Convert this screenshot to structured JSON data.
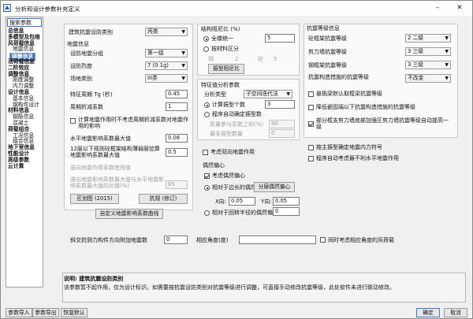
{
  "window": {
    "title": "分析和设计参数补充定义"
  },
  "search": {
    "value": "搜索参数"
  },
  "nav": [
    {
      "label": "总信息",
      "level": 0
    },
    {
      "label": "多模型及包络",
      "level": 0
    },
    {
      "label": "风荷载信息",
      "level": 0
    },
    {
      "label": "地震信息",
      "level": 1
    },
    {
      "label": "隔震信息",
      "level": 1,
      "selected": true
    },
    {
      "label": "活荷载信息",
      "level": 0
    },
    {
      "label": "二阶效应",
      "level": 0
    },
    {
      "label": "调整信息",
      "level": 0
    },
    {
      "label": "刚度调整",
      "level": 1
    },
    {
      "label": "内力调整",
      "level": 1
    },
    {
      "label": "设计信息",
      "level": 0
    },
    {
      "label": "基本信息",
      "level": 1
    },
    {
      "label": "钢构件设计",
      "level": 1
    },
    {
      "label": "材料信息",
      "level": 0
    },
    {
      "label": "钢筋信息",
      "level": 1
    },
    {
      "label": "混凝土",
      "level": 1
    },
    {
      "label": "荷载组合",
      "level": 0
    },
    {
      "label": "工况信息",
      "level": 1
    },
    {
      "label": "组合信息",
      "level": 1
    },
    {
      "label": "地下室信息",
      "level": 0
    },
    {
      "label": "性能设计",
      "level": 0
    },
    {
      "label": "高级参数",
      "level": 0
    },
    {
      "label": "云计算",
      "level": 0
    }
  ],
  "seismic": {
    "category_label": "建筑抗震设防类别",
    "category_value": "丙类",
    "group_title": "地震信息",
    "group_label": "设防地震分组",
    "group_value": "第一组",
    "intensity_label": "设防烈度",
    "intensity_value": "7 (0.1g)",
    "site_label": "场地类别",
    "site_value": "III类",
    "tg_label": "特征周期 Tg (秒)",
    "tg_value": "0.45",
    "period_label": "周期折减系数",
    "period_value": "1",
    "nomin_label": "计算地震作用时不考虑周期折减系数对地震作用的影响",
    "nomin_checked": false,
    "amax_label": "水平地震影响系数最大值",
    "amax_value": "0.08",
    "s12_label": "12层以下规则砼框架结构薄弱层验算地震影响系数最大值",
    "s12_value": "0.5",
    "vert_label": "竖向地震作用系数底线值",
    "vert_value": "0",
    "vert2_label": "竖向地震影响系数最大值与水平地震影响系数最大值的比值(%)",
    "vert2_value": "65",
    "btn_zone": "区划图 (2015)",
    "btn_anzhen": "抗规 (修订)",
    "btn_curve": "自定义地震影响系数曲线"
  },
  "damping": {
    "title": "结构阻尼比 (%)",
    "uniform_label": "全楼统一",
    "uniform_value": "5",
    "uniform_checked": true,
    "material_label": "按材料区分",
    "material_checked": false,
    "steel_label": "钢",
    "steel_value": "2",
    "conc_label": "砼",
    "conc_value": "5",
    "btn": "振型阻尼比"
  },
  "modal": {
    "title": "特征值分析参数",
    "type_label": "分析类型",
    "type_value": "子空间迭代法",
    "count_label": "计算振型个数",
    "count_value": "3",
    "count_checked": true,
    "auto_label": "程序自动确定振型数",
    "auto_checked": false,
    "mass_label": "质量参与系数之和(%)",
    "mass_value": "90",
    "max_label": "最多振型数量",
    "max_value": "0"
  },
  "two_way": {
    "label": "考虑双向地震作用",
    "checked": false
  },
  "ecc": {
    "title": "偶然偏心",
    "consider_label": "考虑偶然偏心",
    "consider_checked": true,
    "rel_label": "相对于边长的偶然偏心",
    "rel_checked": true,
    "btn": "分层偶然偏心",
    "x_label": "X向:",
    "x_value": "0.05",
    "y_label": "Y向:",
    "y_value": "0.05",
    "gyr_label": "相对于回转半径的偶然偏心",
    "gyr_checked": false,
    "gyr_value": "0"
  },
  "grade": {
    "title": "抗震等级信息",
    "frame_label": "砼框架抗震等级",
    "frame_value": "2   二级",
    "shear_label": "剪力墙抗震等级",
    "shear_value": "3   三级",
    "steel_label": "钢框架抗震等级",
    "steel_value": "3   三级",
    "measure_label": "抗震构造措施的抗震等级",
    "measure_value": "不改变",
    "cant_label": "悬挑梁默认取框梁抗震等级",
    "cant_checked": false,
    "low_label": "降低嵌固端以下抗震构造措施的抗震等级",
    "low_checked": false,
    "part_label": "部分框支剪力墙底部加强区剪力墙抗震等级自动提高一级",
    "part_checked": true
  },
  "lower": {
    "sec_label": "按主振型确定地震内力符号",
    "sec_checked": false,
    "auto_label": "程序自动考虑最不利水平地震作用",
    "auto_checked": false
  },
  "bottom": {
    "oblique_label": "斜交抗侧力构件方向附加地震数",
    "oblique_value": "0",
    "angle_label": "相应角度(度)",
    "angle_value": "",
    "wind_label": "同时考虑相应角度的风荷载",
    "wind_checked": false
  },
  "desc": {
    "title": "说明: 建筑抗震设防类别",
    "text": "该参数暂不起作用，仅为设计标识。如需要按抗震设防类别对抗震等级进行调整，可直接手动修改抗震等级，此处软件未进行联动修改。"
  },
  "footer": {
    "import": "参数导入",
    "export": "参数导出",
    "restore": "恢复默认",
    "ok": "确定",
    "cancel": "取消"
  }
}
